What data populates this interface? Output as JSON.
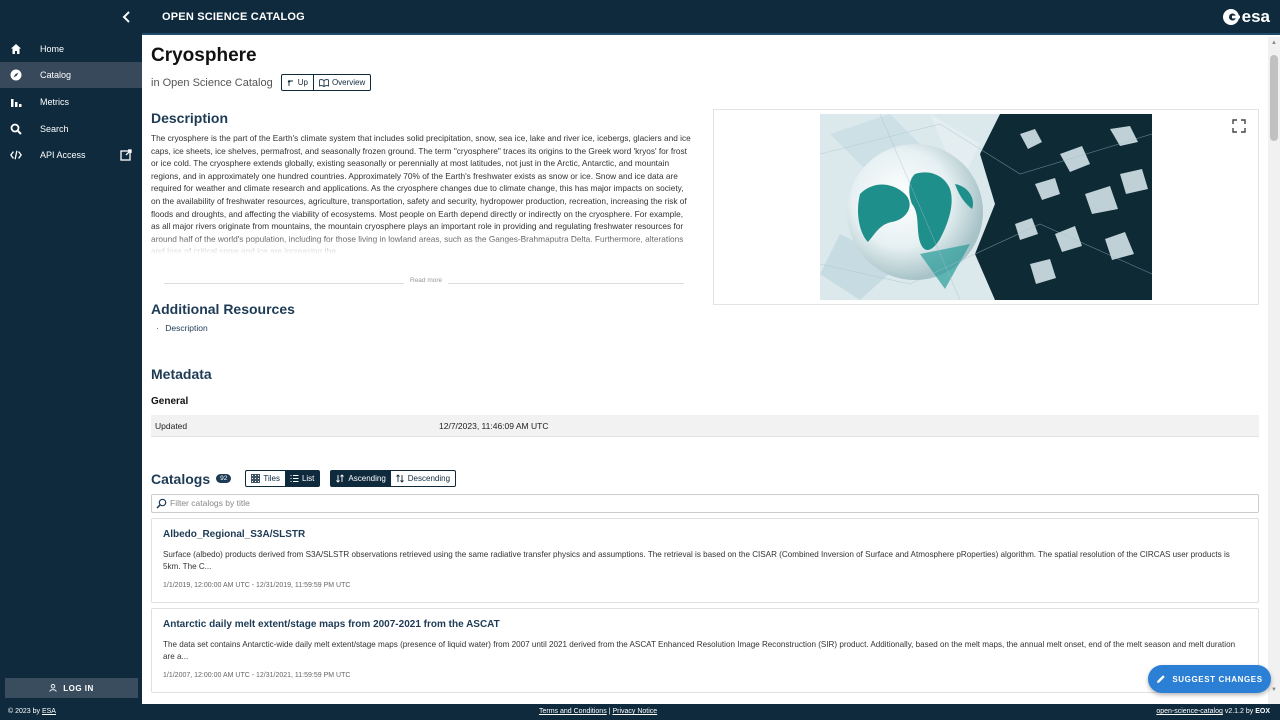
{
  "sidebar": {
    "items": [
      {
        "label": "Home",
        "icon": "home-icon"
      },
      {
        "label": "Catalog",
        "icon": "compass-icon"
      },
      {
        "label": "Metrics",
        "icon": "bar-chart-icon"
      },
      {
        "label": "Search",
        "icon": "search-icon"
      },
      {
        "label": "API Access",
        "icon": "code-icon"
      }
    ],
    "login_label": "LOG IN"
  },
  "header": {
    "title": "OPEN SCIENCE CATALOG",
    "logo_text": "esa"
  },
  "page": {
    "title": "Cryosphere",
    "in_catalog_prefix": "in",
    "in_catalog_name": "Open Science Catalog",
    "up_label": "Up",
    "overview_label": "Overview"
  },
  "description": {
    "heading": "Description",
    "text": "The cryosphere is the part of the Earth's climate system that includes solid precipitation, snow, sea ice, lake and river ice, icebergs, glaciers and ice caps, ice sheets, ice shelves, permafrost, and seasonally frozen ground. The term \"cryosphere\" traces its origins to the Greek word 'kryos' for frost or ice cold. The cryosphere extends globally, existing seasonally or perennially at most latitudes, not just in the Arctic, Antarctic, and mountain regions, and in approximately one hundred countries. Approximately 70% of the Earth's freshwater exists as snow or ice. Snow and ice data are required for weather and climate research and applications. As the cryosphere changes due to climate change, this has major impacts on society, on the availability of freshwater resources, agriculture, transportation, safety and security, hydropower production, recreation, increasing the risk of floods and droughts, and affecting the viability of ecosystems. Most people on Earth depend directly or indirectly on the cryosphere. For example, as all major rivers originate from mountains, the mountain cryosphere plays an important role in providing and regulating freshwater resources for around half of the world's population, including for those living in lowland areas, such as the Ganges-Brahmaputra Delta. Furthermore, alterations and loss of critical snow and ice are increasing the",
    "read_more": "Read more"
  },
  "resources": {
    "heading": "Additional Resources",
    "items": [
      "Description"
    ]
  },
  "metadata": {
    "heading": "Metadata",
    "subheading": "General",
    "rows": [
      {
        "key": "Updated",
        "value": "12/7/2023, 11:46:09 AM UTC"
      }
    ]
  },
  "catalogs": {
    "heading": "Catalogs",
    "count": "92",
    "tiles_label": "Tiles",
    "list_label": "List",
    "ascending_label": "Ascending",
    "descending_label": "Descending",
    "filter_placeholder": "Filter catalogs by title",
    "items": [
      {
        "title": "Albedo_Regional_S3A/SLSTR",
        "description": "Surface (albedo) products derived from S3A/SLSTR observations retrieved using the same radiative transfer physics and assumptions. The retrieval is based on the CISAR (Combined Inversion of Surface and Atmosphere pRoperties) algorithm. The spatial resolution of the CIRCAS user products is 5km. The C...",
        "dates": "1/1/2019, 12:00:00 AM UTC - 12/31/2019, 11:59:59 PM UTC"
      },
      {
        "title": "Antarctic daily melt extent/stage maps from 2007-2021 from the ASCAT",
        "description": "The data set contains Antarctic-wide daily melt extent/stage maps (presence of liquid water) from 2007 until 2021 derived from the ASCAT Enhanced Resolution Image Reconstruction (SIR) product. Additionally, based on the melt maps, the annual melt onset, end of the melt season and melt duration are a...",
        "dates": "1/1/2007, 12:00:00 AM UTC - 12/31/2021, 11:59:59 PM UTC"
      }
    ]
  },
  "suggest_label": "SUGGEST CHANGES",
  "footer": {
    "copyright_prefix": "© 2023 by",
    "copyright_link": "ESA",
    "terms": "Terms and Conditions",
    "separator": "|",
    "privacy": "Privacy Notice",
    "version_link": "open-science-catalog",
    "version_text": "v2.1.2 by",
    "eox": "EOX"
  },
  "colors": {
    "sidebar_bg": "#0f2a3d",
    "active_item": "#37495a",
    "accent_blue": "#2b7fd4",
    "heading": "#1e3b55"
  }
}
